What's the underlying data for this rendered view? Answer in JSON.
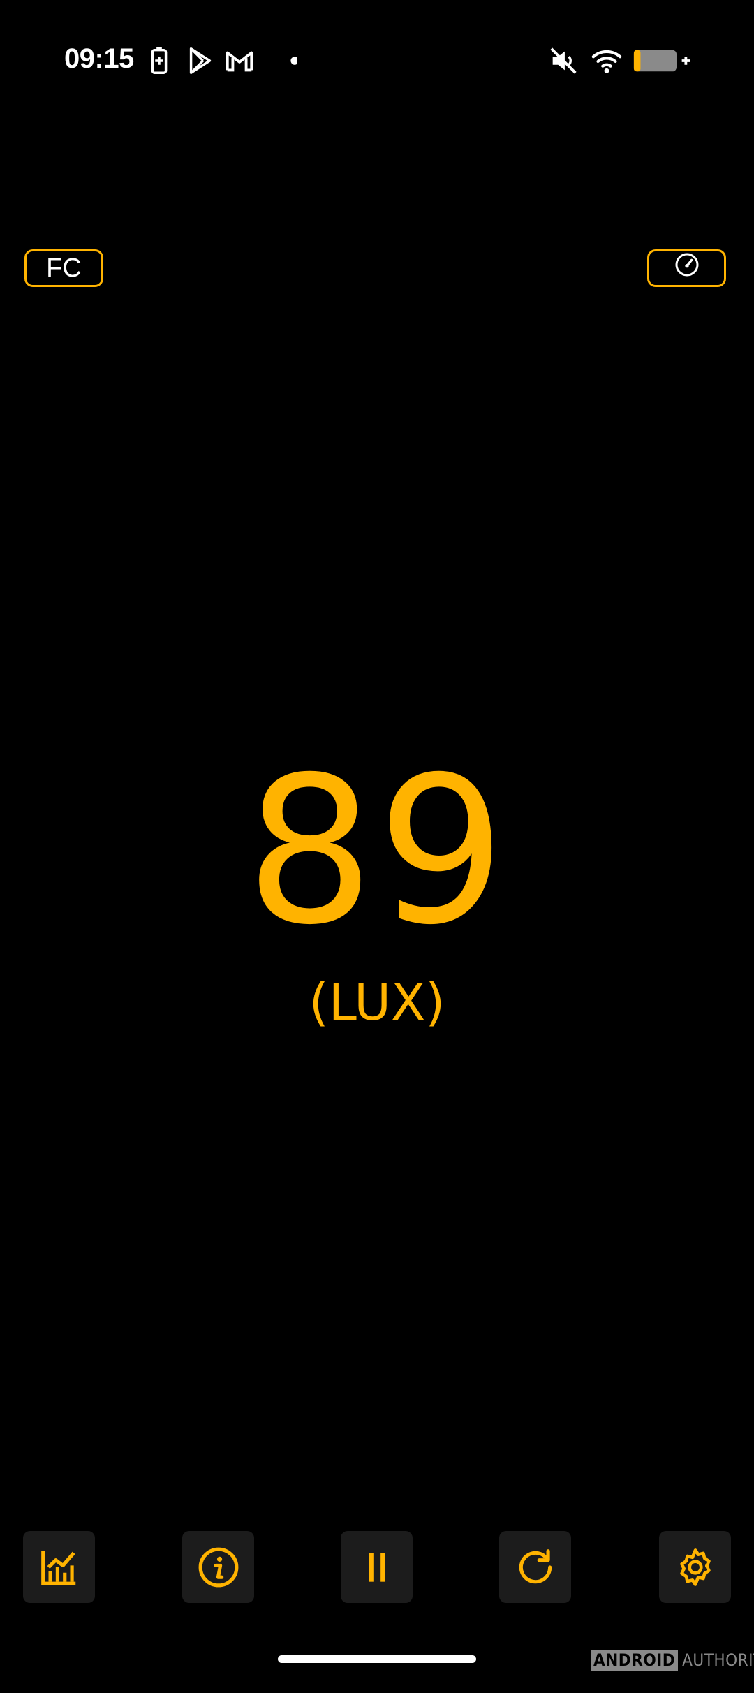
{
  "status_bar": {
    "time": "09:15",
    "left_icons": [
      "battery-saver-icon",
      "play-store-icon",
      "gmail-icon",
      "notification-dot-icon"
    ],
    "right_icons": [
      "mute-icon",
      "wifi-icon",
      "battery-charging-icon"
    ]
  },
  "top_bar": {
    "unit_toggle_label": "FC",
    "meter_icon": "speedometer-icon"
  },
  "reading": {
    "value": "89",
    "unit": "(LUX)"
  },
  "toolbar": {
    "items": [
      {
        "name": "chart",
        "icon": "chart-icon"
      },
      {
        "name": "info",
        "icon": "info-icon"
      },
      {
        "name": "pause",
        "icon": "pause-icon"
      },
      {
        "name": "reset",
        "icon": "refresh-icon"
      },
      {
        "name": "settings",
        "icon": "gear-icon"
      }
    ]
  },
  "watermark": {
    "boxed": "ANDROID",
    "text": "AUTHORITY"
  },
  "colors": {
    "accent": "#ffb300",
    "background": "#000000",
    "button_bg": "#1c1c1c"
  }
}
